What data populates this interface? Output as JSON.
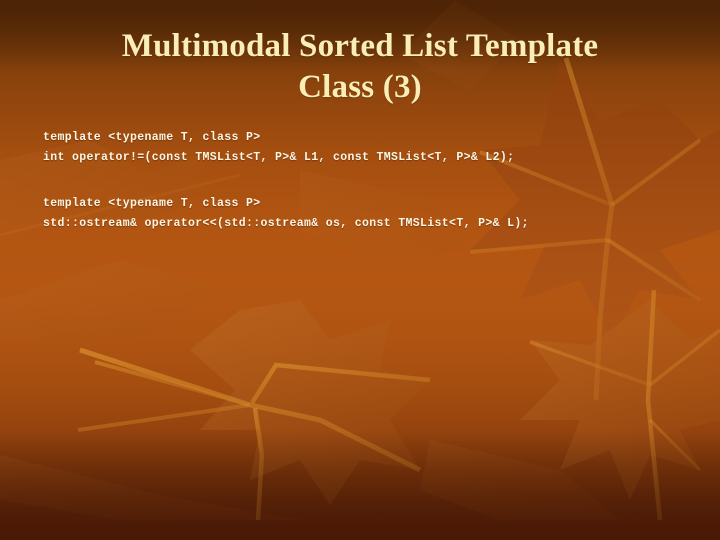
{
  "slide": {
    "title_line_1": "Multimodal Sorted List Template",
    "title_line_2": "Class (3)",
    "title_full": "Multimodal Sorted List Template\nClass (3)",
    "colors": {
      "title_text": "#f8eeb6",
      "code_text": "#fdf6e4",
      "background_top": "#5f2f06",
      "background_middle": "#b55713",
      "background_bottom": "#581f07",
      "leaf_light": "#d2832a",
      "leaf_dark": "#8e3d0b"
    },
    "background_theme": "autumn-maple-leaves",
    "code_blocks": [
      {
        "lines": [
          "template <typename T, class P>",
          "int operator!=(const TMSList<T, P>& L1, const TMSList<T, P>& L2);"
        ]
      },
      {
        "lines": [
          "template <typename T, class P>",
          "std::ostream& operator<<(std::ostream& os, const TMSList<T, P>& L);"
        ]
      }
    ]
  }
}
